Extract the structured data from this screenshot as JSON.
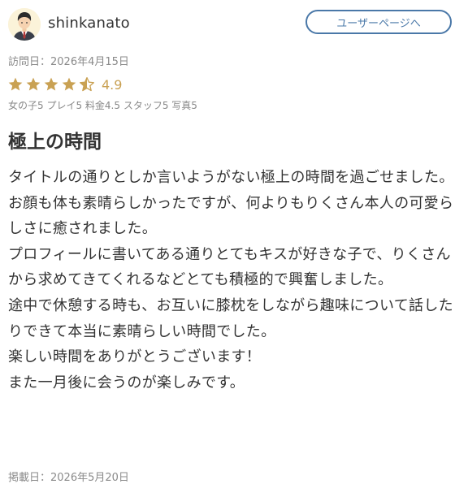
{
  "user": {
    "name": "shinkanato",
    "page_button_label": "ユーザーページへ"
  },
  "visit": {
    "label": "訪問日：2026年4月15日"
  },
  "rating": {
    "stars": 4.5,
    "value": "4.9",
    "star_color": "#c9a153"
  },
  "subscores": {
    "girl": "女の子5",
    "play": "プレイ5",
    "price": "料金4.5",
    "staff": "スタッフ5",
    "photo": "写真5"
  },
  "review": {
    "title": "極上の時間",
    "body": "タイトルの通りとしか言いようがない極上の時間を過ごせました。お顔も体も素晴らしかったですが、何よりもりくさん本人の可愛らしさに癒されました。\nプロフィールに書いてある通りとてもキスが好きな子で、りくさんから求めてきてくれるなどとても積極的で興奮しました。\n途中で休憩する時も、お互いに膝枕をしながら趣味について話したりできて本当に素晴らしい時間でした。\n楽しい時間をありがとうございます！\nまた一月後に会うのが楽しみです。"
  },
  "posted": {
    "label": "掲載日：2026年5月20日"
  },
  "colors": {
    "accent": "#4a78a8",
    "muted": "#8a8a8a"
  }
}
